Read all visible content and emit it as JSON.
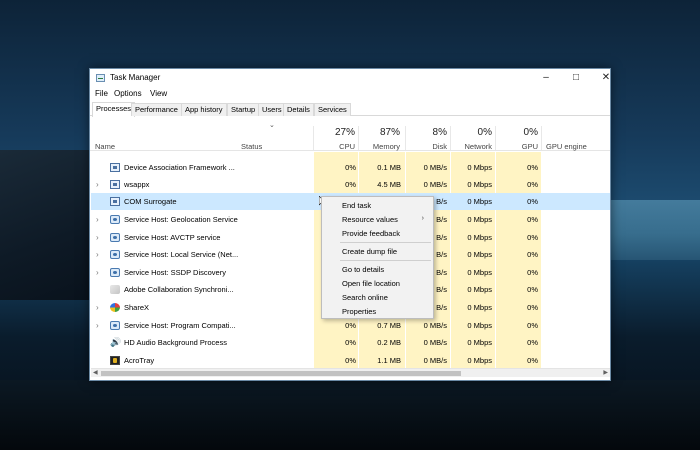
{
  "window": {
    "title": "Task Manager",
    "minimize_icon": "minimize-icon",
    "maximize_icon": "maximize-icon",
    "close_icon": "close-icon"
  },
  "menubar": {
    "items": [
      "File",
      "Options",
      "View"
    ]
  },
  "tabs": [
    "Processes",
    "Performance",
    "App history",
    "Startup",
    "Users",
    "Details",
    "Services"
  ],
  "active_tab": "Processes",
  "columns": {
    "name": "Name",
    "status": "Status",
    "cpu": {
      "label": "CPU",
      "pct": "27%"
    },
    "memory": {
      "label": "Memory",
      "pct": "87%"
    },
    "disk": {
      "label": "Disk",
      "pct": "8%"
    },
    "network": {
      "label": "Network",
      "pct": "0%"
    },
    "gpu": {
      "label": "GPU",
      "pct": "0%"
    },
    "gpu_engine": "GPU engine"
  },
  "processes": [
    {
      "name": "Device Association Framework ...",
      "icon": "app-icon",
      "expandable": false,
      "cpu": "0%",
      "memory": "0.1 MB",
      "disk": "0 MB/s",
      "network": "0 Mbps",
      "gpu": "0%"
    },
    {
      "name": "wsappx",
      "icon": "app-icon",
      "expandable": true,
      "cpu": "0%",
      "memory": "4.5 MB",
      "disk": "0 MB/s",
      "network": "0 Mbps",
      "gpu": "0%"
    },
    {
      "name": "COM Surrogate",
      "icon": "app-icon",
      "expandable": false,
      "selected": true,
      "cpu": "",
      "memory": "",
      "disk": "B/s",
      "network": "0 Mbps",
      "gpu": "0%"
    },
    {
      "name": "Service Host: Geolocation Service",
      "icon": "gear-icon",
      "expandable": true,
      "cpu": "",
      "memory": "",
      "disk": "B/s",
      "network": "0 Mbps",
      "gpu": "0%"
    },
    {
      "name": "Service Host: AVCTP service",
      "icon": "gear-icon",
      "expandable": true,
      "cpu": "",
      "memory": "",
      "disk": "B/s",
      "network": "0 Mbps",
      "gpu": "0%"
    },
    {
      "name": "Service Host: Local Service (Net...",
      "icon": "gear-icon",
      "expandable": true,
      "cpu": "",
      "memory": "",
      "disk": "B/s",
      "network": "0 Mbps",
      "gpu": "0%"
    },
    {
      "name": "Service Host: SSDP Discovery",
      "icon": "gear-icon",
      "expandable": true,
      "cpu": "",
      "memory": "",
      "disk": "B/s",
      "network": "0 Mbps",
      "gpu": "0%"
    },
    {
      "name": "Adobe Collaboration Synchroni...",
      "icon": "adobe-icon",
      "expandable": false,
      "cpu": "",
      "memory": "",
      "disk": "B/s",
      "network": "0 Mbps",
      "gpu": "0%"
    },
    {
      "name": "ShareX",
      "icon": "sharex-icon",
      "expandable": true,
      "cpu": "",
      "memory": "",
      "disk": "B/s",
      "network": "0 Mbps",
      "gpu": "0%"
    },
    {
      "name": "Service Host: Program Compati...",
      "icon": "gear-icon",
      "expandable": true,
      "cpu": "0%",
      "memory": "0.7 MB",
      "disk": "0 MB/s",
      "network": "0 Mbps",
      "gpu": "0%"
    },
    {
      "name": "HD Audio Background Process",
      "icon": "speaker-icon",
      "expandable": false,
      "cpu": "0%",
      "memory": "0.2 MB",
      "disk": "0 MB/s",
      "network": "0 Mbps",
      "gpu": "0%"
    },
    {
      "name": "AcroTray",
      "icon": "acrotray-icon",
      "expandable": false,
      "cpu": "0%",
      "memory": "1.1 MB",
      "disk": "0 MB/s",
      "network": "0 Mbps",
      "gpu": "0%"
    }
  ],
  "context_menu": {
    "items": [
      "End task",
      "Resource values",
      "Provide feedback",
      "Create dump file",
      "Go to details",
      "Open file location",
      "Search online",
      "Properties"
    ],
    "submenu_arrow": "›"
  },
  "colors": {
    "accent_selected": "#cce8ff",
    "usage_tint": "#fff4c4"
  }
}
